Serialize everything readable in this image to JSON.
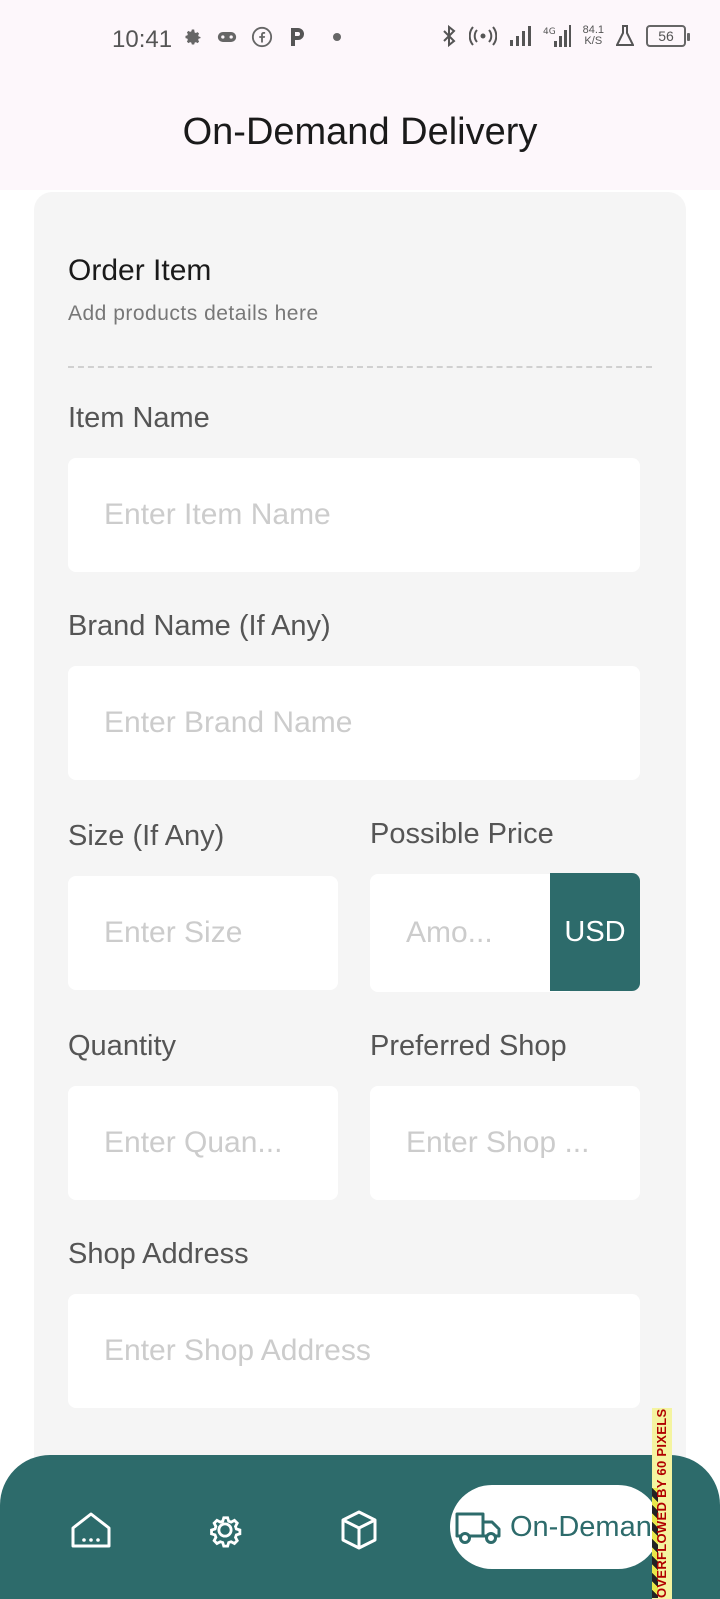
{
  "status_bar": {
    "time": "10:41",
    "network_speed_value": "84.1",
    "network_speed_unit": "K/S",
    "battery": "56",
    "left_icons": [
      "gear-icon",
      "gamepad-icon",
      "facebook-icon",
      "p-icon",
      "dot-icon"
    ],
    "right_icons": [
      "bluetooth-icon",
      "hotspot-icon",
      "signal-icon",
      "4g-signal-icon",
      "flask-icon",
      "battery-icon"
    ]
  },
  "app_bar": {
    "title": "On-Demand Delivery"
  },
  "form": {
    "section_title": "Order Item",
    "section_subtitle": "Add products details here",
    "item_name": {
      "label": "Item Name",
      "placeholder": "Enter Item Name"
    },
    "brand_name": {
      "label": "Brand Name (If Any)",
      "placeholder": "Enter Brand Name"
    },
    "size": {
      "label": "Size (If Any)",
      "placeholder": "Enter Size"
    },
    "price": {
      "label": "Possible Price",
      "placeholder": "Amo...",
      "currency": "USD"
    },
    "quantity": {
      "label": "Quantity",
      "placeholder": "Enter Quan..."
    },
    "preferred_shop": {
      "label": "Preferred Shop",
      "placeholder": "Enter Shop ..."
    },
    "shop_address": {
      "label": "Shop Address",
      "placeholder": "Enter Shop Address"
    }
  },
  "bottom_nav": {
    "items": [
      {
        "icon": "home-icon"
      },
      {
        "icon": "settings-icon"
      },
      {
        "icon": "package-icon"
      },
      {
        "icon": "truck-icon",
        "label": "On-Deman",
        "active": true
      }
    ]
  },
  "debug": {
    "overflow_text": "OVERFLOWED BY 60 PIXELS"
  },
  "colors": {
    "primary": "#2d6b6b",
    "card_bg": "#f5f5f5",
    "app_bar_bg": "#fdf7fb",
    "placeholder": "#cccccc"
  }
}
